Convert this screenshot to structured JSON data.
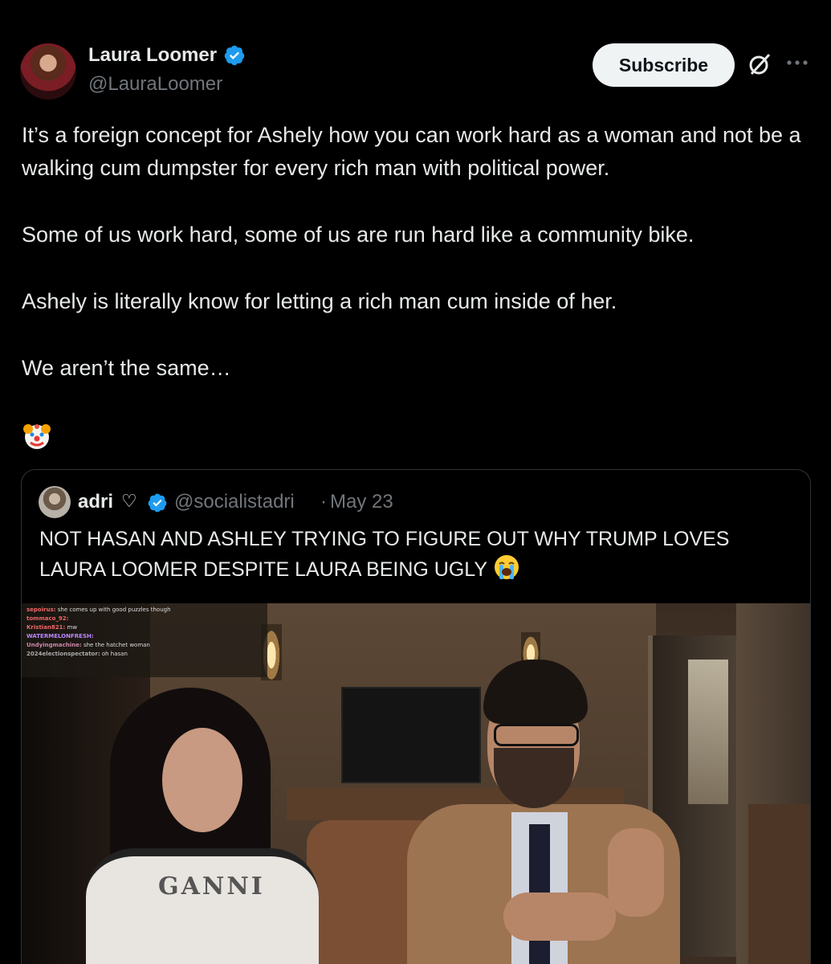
{
  "author": {
    "name": "Laura Loomer",
    "handle": "@LauraLoomer",
    "verified": true
  },
  "actions": {
    "subscribe_label": "Subscribe",
    "grok_icon": "grok-icon",
    "more_icon": "more-icon"
  },
  "tweet": {
    "paragraphs": [
      "It’s a foreign concept for Ashely how you can work hard as a woman and not be a walking cum dumpster for every rich man with political power.",
      "Some of us work hard, some of us are run hard like a community bike.",
      "Ashely is literally know  for letting a rich man cum inside of her.",
      "We aren’t the same…"
    ],
    "emoji": "clown-face"
  },
  "quote": {
    "name": "adri",
    "heart": "♡",
    "handle": "@socialistadri",
    "separator": "·",
    "date": "May 23",
    "text": "NOT HASAN AND ASHLEY TRYING TO FIGURE OUT WHY TRUMP LOVES LAURA LOOMER DESPITE LAURA BEING UGLY",
    "text_emoji": "loudly-crying-face",
    "media": {
      "chat_lines": [
        {
          "user": "sepoirus:",
          "msg": "she comes up with good puzzles though"
        },
        {
          "user": "tommaco_92:",
          "msg": ""
        },
        {
          "user": "Kristian821:",
          "msg": "mw"
        },
        {
          "user": "WATERMELONFRESH:",
          "msg": ""
        },
        {
          "user": "Undyingmachine:",
          "msg": "she the hatchet woman"
        },
        {
          "user": "2024electionspectator:",
          "msg": "oh hasan"
        }
      ],
      "shirt_text": "GANNI"
    }
  },
  "colors": {
    "background": "#000000",
    "text": "#e7e9ea",
    "secondary_text": "#71767b",
    "verified_blue": "#1d9bf0",
    "border": "#2f3336"
  }
}
